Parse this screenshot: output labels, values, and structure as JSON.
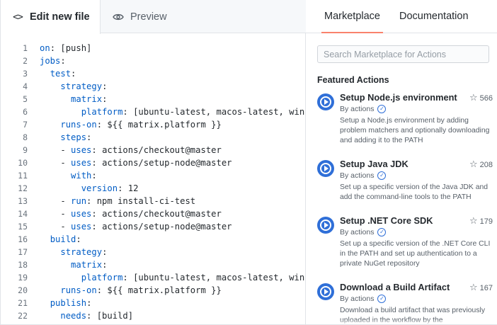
{
  "editor": {
    "tabs": {
      "edit": {
        "label": "Edit new file",
        "icon": "code-icon"
      },
      "preview": {
        "label": "Preview",
        "icon": "eye-icon"
      }
    },
    "lines": [
      {
        "num": "1",
        "indent": "",
        "key": "on",
        "rest": ": [push]"
      },
      {
        "num": "2",
        "indent": "",
        "key": "jobs",
        "rest": ":"
      },
      {
        "num": "3",
        "indent": "  ",
        "key": "test",
        "rest": ":"
      },
      {
        "num": "4",
        "indent": "    ",
        "key": "strategy",
        "rest": ":"
      },
      {
        "num": "5",
        "indent": "      ",
        "key": "matrix",
        "rest": ":"
      },
      {
        "num": "6",
        "indent": "        ",
        "key": "platform",
        "rest": ": [ubuntu-latest, macos-latest, win"
      },
      {
        "num": "7",
        "indent": "    ",
        "key": "runs-on",
        "rest": ": ${{ matrix.platform }}"
      },
      {
        "num": "8",
        "indent": "    ",
        "key": "steps",
        "rest": ":"
      },
      {
        "num": "9",
        "indent": "    - ",
        "key": "uses",
        "rest": ": actions/checkout@master"
      },
      {
        "num": "10",
        "indent": "    - ",
        "key": "uses",
        "rest": ": actions/setup-node@master"
      },
      {
        "num": "11",
        "indent": "      ",
        "key": "with",
        "rest": ":"
      },
      {
        "num": "12",
        "indent": "        ",
        "key": "version",
        "rest": ": 12"
      },
      {
        "num": "13",
        "indent": "    - ",
        "key": "run",
        "rest": ": npm install-ci-test"
      },
      {
        "num": "14",
        "indent": "    - ",
        "key": "uses",
        "rest": ": actions/checkout@master"
      },
      {
        "num": "15",
        "indent": "    - ",
        "key": "uses",
        "rest": ": actions/setup-node@master"
      },
      {
        "num": "16",
        "indent": "  ",
        "key": "build",
        "rest": ":"
      },
      {
        "num": "17",
        "indent": "    ",
        "key": "strategy",
        "rest": ":"
      },
      {
        "num": "18",
        "indent": "      ",
        "key": "matrix",
        "rest": ":"
      },
      {
        "num": "19",
        "indent": "        ",
        "key": "platform",
        "rest": ": [ubuntu-latest, macos-latest, win"
      },
      {
        "num": "20",
        "indent": "    ",
        "key": "runs-on",
        "rest": ": ${{ matrix.platform }}"
      },
      {
        "num": "21",
        "indent": "  ",
        "key": "publish",
        "rest": ":"
      },
      {
        "num": "22",
        "indent": "    ",
        "key": "needs",
        "rest": ": [build]"
      }
    ],
    "key_color": "#005cc5"
  },
  "marketplace": {
    "tabs": {
      "marketplace": "Marketplace",
      "documentation": "Documentation"
    },
    "active_tab_color": "#f9826c",
    "search_placeholder": "Search Marketplace for Actions",
    "featured_heading": "Featured Actions",
    "actions": [
      {
        "name": "Setup Node.js environment",
        "stars": "566",
        "by": "By actions",
        "description": "Setup a Node.js environment by adding problem matchers and optionally downloading and adding it to the PATH"
      },
      {
        "name": "Setup Java JDK",
        "stars": "208",
        "by": "By actions",
        "description": "Set up a specific version of the Java JDK and add the command-line tools to the PATH"
      },
      {
        "name": "Setup .NET Core SDK",
        "stars": "179",
        "by": "By actions",
        "description": "Set up a specific version of the .NET Core CLI in the PATH and set up authentication to a private NuGet repository"
      },
      {
        "name": "Download a Build Artifact",
        "stars": "167",
        "by": "By actions",
        "description": "Download a build artifact that was previously uploaded in the workflow by the"
      }
    ],
    "action_icon_color": "#2f6fd8"
  }
}
